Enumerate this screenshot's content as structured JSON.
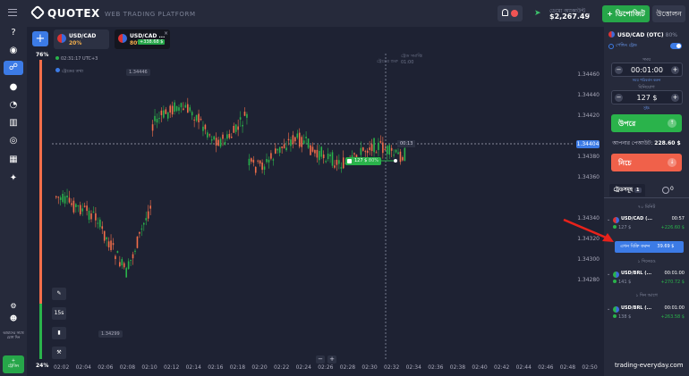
{
  "header": {
    "brand": "QUOTEX",
    "platform": "WEB TRADING PLATFORM",
    "account_label": "ডেমো অ্যাকাউন্ট",
    "balance": "$2,267.49",
    "deposit_label": "+ ডিপোজিট",
    "withdraw_label": "উত্তোলন",
    "notification_count": "88"
  },
  "nav": {
    "items": [
      "help-icon",
      "profile-icon",
      "chart-icon",
      "user-icon",
      "pie-icon",
      "trophy-icon",
      "signal-icon",
      "analytics-icon",
      "gift-icon"
    ],
    "bottom_label": "আমাদের সাথে যোগ দিন",
    "live_label": "ট্রেডিং"
  },
  "chart": {
    "sentiment_top": "76%",
    "sentiment_bottom": "24%",
    "tabs": [
      {
        "name": "USD/CAD",
        "pct": "20%"
      },
      {
        "name": "USD/CAD ...",
        "pct": "80%",
        "badge": "+338.68 $"
      }
    ],
    "clock": "02:31:17 UTC+3",
    "trades_toggle": "ট্রেডের তথ্য",
    "trade_line_label": "ট্রেডের শুরু",
    "expire_label": "ট্রেড সমাপ্তি",
    "expire_time": "01:00",
    "high_marker": "1.34446",
    "low_marker": "1.34299",
    "current_price": "1.34404",
    "countdown": "00:13",
    "trade_tag": "127 $",
    "trade_tag_profit": "80%",
    "tool_timeframe": "15s",
    "price_ticks": [
      "1.34460",
      "1.34440",
      "1.34420",
      "1.34380",
      "1.34360",
      "1.34340",
      "1.34320",
      "1.34300",
      "1.34280"
    ],
    "time_ticks": [
      "02:02",
      "02:04",
      "02:06",
      "02:08",
      "02:10",
      "02:12",
      "02:14",
      "02:16",
      "02:18",
      "02:20",
      "02:22",
      "02:24",
      "02:26",
      "02:28",
      "02:30",
      "02:32",
      "02:34",
      "02:36",
      "02:38",
      "02:40",
      "02:42",
      "02:44",
      "02:46",
      "02:48",
      "02:50"
    ]
  },
  "panel": {
    "asset": "USD/CAD (OTC)",
    "asset_pct": "80%",
    "pending_label": "পেন্ডিং ট্রেড",
    "time_label": "সময়",
    "time_value": "00:01:00",
    "time_sub": "সময় পরিবর্তন করুন",
    "amount_label": "বিনিয়োগ",
    "amount_value": "127 $",
    "amount_sub": "সুইচ",
    "up_label": "উপরে",
    "payout_label": "আপনার পেআউট:",
    "payout_value": "228.60 $",
    "down_label": "নিচে",
    "trades_tab": "ট্রেডসমূহ",
    "trades_count": "1",
    "closed_count": "0",
    "sections": {
      "now": "৭০ মিনিট",
      "one_day": "১ দিনেরও",
      "yesterday": "১ দিন আগে"
    },
    "sell_label": "এখন বিক্রি করুন",
    "sell_value": "39.69 $",
    "trades": [
      {
        "name": "USD/CAD (...",
        "time": "00:57",
        "amount": "127 $",
        "profit": "+226.60 $"
      },
      {
        "name": "USD/BRL (...",
        "time": "00:01:00",
        "amount": "141 $",
        "profit": "+270.72 $"
      },
      {
        "name": "USD/BRL (...",
        "time": "00:01:00",
        "amount": "138 $",
        "profit": "+263.58 $"
      }
    ]
  },
  "watermark": "trading-everyday.com",
  "colors": {
    "up": "#2ab34b",
    "down": "#f0614a",
    "accent": "#3c7be6",
    "bg": "#1e2233"
  }
}
